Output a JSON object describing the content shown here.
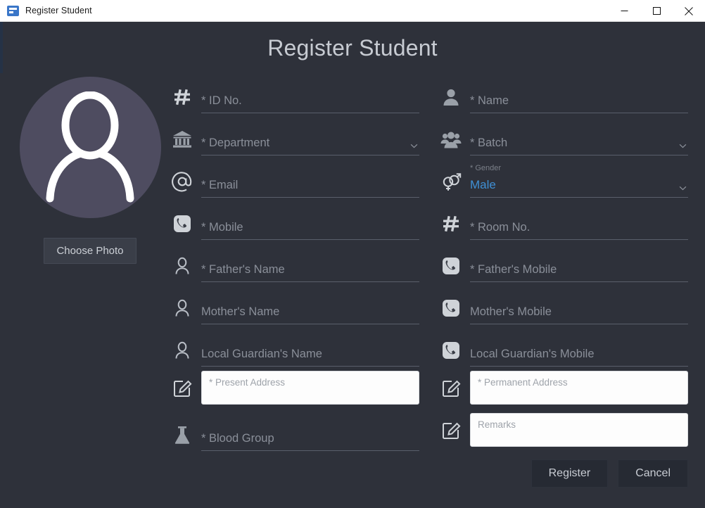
{
  "window": {
    "title": "Register Student",
    "icon": "app-icon",
    "controls": [
      {
        "name": "minimize-button",
        "glyph": "minimize-icon"
      },
      {
        "name": "maximize-button",
        "glyph": "maximize-icon"
      },
      {
        "name": "close-button",
        "glyph": "close-icon"
      }
    ]
  },
  "page": {
    "heading": "Register Student"
  },
  "photo": {
    "avatar_icon": "person-placeholder-icon",
    "avatar_bg": "#4e4c60",
    "choose_photo_label": "Choose Photo"
  },
  "colors": {
    "background": "#2e313a",
    "accent_blue": "#3f8fd4",
    "placeholder": "#8a8f99",
    "underline": "#5a5f6b",
    "titlebar_bg": "#ffffff"
  },
  "form": {
    "left": [
      {
        "name": "id-no-field",
        "icon": "hash-icon",
        "placeholder": "* ID No.",
        "type": "line"
      },
      {
        "name": "department-field",
        "icon": "bank-icon",
        "placeholder": "* Department",
        "type": "select"
      },
      {
        "name": "email-field",
        "icon": "at-icon",
        "placeholder": "* Email",
        "type": "line"
      },
      {
        "name": "mobile-field",
        "icon": "phone-icon",
        "placeholder": "* Mobile",
        "type": "line"
      },
      {
        "name": "fathers-name-field",
        "icon": "person-icon",
        "placeholder": "* Father's Name",
        "type": "line"
      },
      {
        "name": "mothers-name-field",
        "icon": "person-icon",
        "placeholder": "Mother's Name",
        "type": "line"
      },
      {
        "name": "local-guardians-name-field",
        "icon": "person-icon",
        "placeholder": "Local Guardian's Name",
        "type": "line"
      },
      {
        "name": "present-address-field",
        "icon": "edit-box-icon",
        "placeholder": "* Present Address",
        "type": "box"
      },
      {
        "name": "blood-group-field",
        "icon": "flask-icon",
        "placeholder": "* Blood Group",
        "type": "line"
      }
    ],
    "right": [
      {
        "name": "name-field",
        "icon": "person-filled-icon",
        "placeholder": "* Name",
        "type": "line"
      },
      {
        "name": "batch-field",
        "icon": "group-icon",
        "placeholder": "* Batch",
        "type": "select"
      },
      {
        "name": "gender-field",
        "icon": "gender-icon",
        "label": "* Gender",
        "value": "Male",
        "type": "select-filled"
      },
      {
        "name": "room-no-field",
        "icon": "hash-icon",
        "placeholder": "* Room No.",
        "type": "line"
      },
      {
        "name": "fathers-mobile-field",
        "icon": "phone-icon",
        "placeholder": "* Father's Mobile",
        "type": "line"
      },
      {
        "name": "mothers-mobile-field",
        "icon": "phone-icon",
        "placeholder": "Mother's Mobile",
        "type": "line"
      },
      {
        "name": "local-guardians-mobile-field",
        "icon": "phone-icon",
        "placeholder": "Local Guardian's Mobile",
        "type": "line"
      },
      {
        "name": "permanent-address-field",
        "icon": "edit-box-icon",
        "placeholder": "* Permanent Address",
        "type": "box"
      },
      {
        "name": "remarks-field",
        "icon": "edit-box-icon",
        "placeholder": "Remarks",
        "type": "box"
      }
    ]
  },
  "actions": {
    "register_label": "Register",
    "cancel_label": "Cancel"
  }
}
